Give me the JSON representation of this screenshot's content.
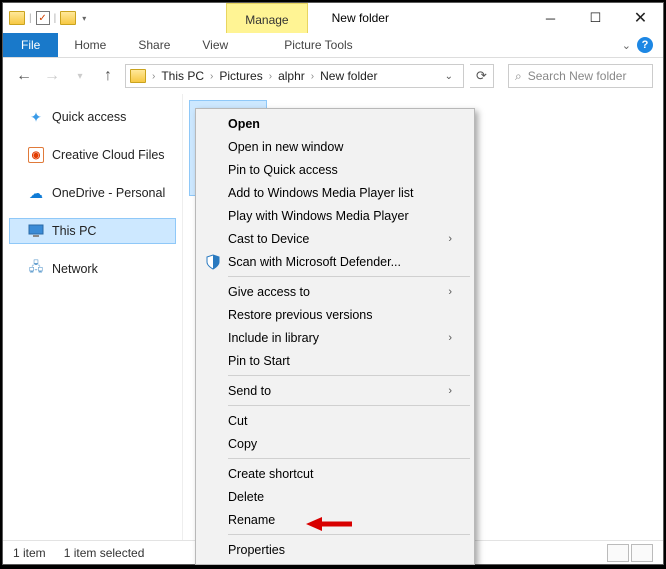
{
  "title": "New folder",
  "manage_tab": "Manage",
  "ribbon": {
    "file": "File",
    "home": "Home",
    "share": "Share",
    "view": "View",
    "picture_tools": "Picture Tools"
  },
  "breadcrumbs": [
    "This PC",
    "Pictures",
    "alphr",
    "New folder"
  ],
  "search_placeholder": "Search New folder",
  "nav_pane": {
    "quick_access": "Quick access",
    "creative_cloud": "Creative Cloud Files",
    "onedrive": "OneDrive - Personal",
    "this_pc": "This PC",
    "network": "Network"
  },
  "context_menu": {
    "open": "Open",
    "open_new_window": "Open in new window",
    "pin_quick_access": "Pin to Quick access",
    "add_wmp_list": "Add to Windows Media Player list",
    "play_wmp": "Play with Windows Media Player",
    "cast": "Cast to Device",
    "defender": "Scan with Microsoft Defender...",
    "give_access": "Give access to",
    "restore": "Restore previous versions",
    "include_library": "Include in library",
    "pin_start": "Pin to Start",
    "send_to": "Send to",
    "cut": "Cut",
    "copy": "Copy",
    "create_shortcut": "Create shortcut",
    "delete": "Delete",
    "rename": "Rename",
    "properties": "Properties"
  },
  "status": {
    "count": "1 item",
    "selected": "1 item selected"
  }
}
